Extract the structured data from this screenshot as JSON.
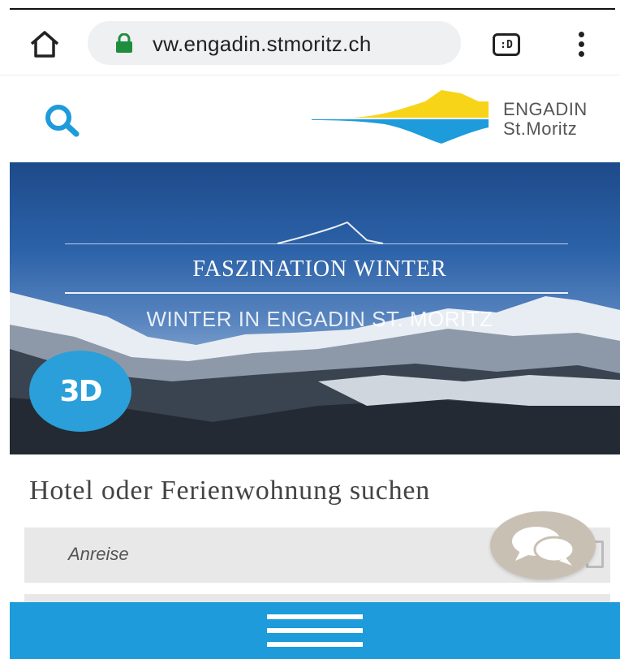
{
  "browser": {
    "url": "vw.engadin.stmoritz.ch",
    "tabs_label": ":D",
    "icons": {
      "home": "home-icon",
      "lock": "lock-icon",
      "tabs": "tabs-icon",
      "menu": "more-vert-icon"
    },
    "lock_color": "#1e8e3e"
  },
  "header": {
    "logo_line1": "ENGADIN",
    "logo_line2": "St.Moritz",
    "search_icon": "search-icon",
    "accent_color": "#1d9bdb"
  },
  "hero": {
    "title": "FASZINATION WINTER",
    "subtitle": "WINTER IN ENGADIN ST. MORITZ",
    "badge_label": "3D"
  },
  "search": {
    "heading": "Hotel oder Ferienwohnung suchen",
    "arrival_placeholder": "Anreise"
  },
  "chat": {
    "icon": "chat-icon"
  },
  "nav": {
    "icon": "hamburger-menu-icon",
    "color": "#1d9bdb"
  }
}
